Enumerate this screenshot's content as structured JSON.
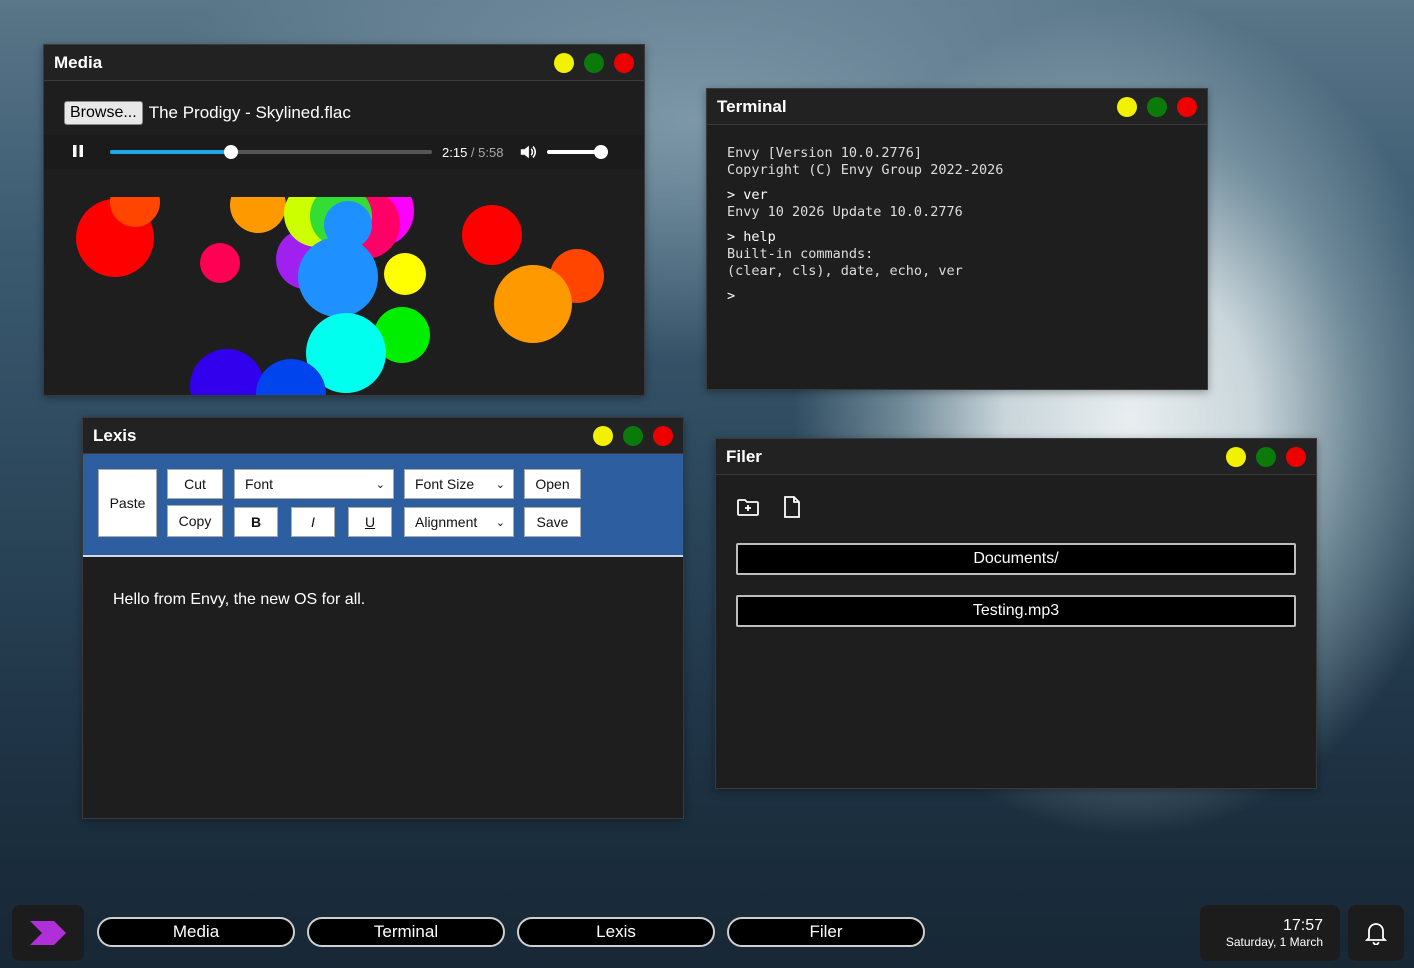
{
  "media": {
    "title": "Media",
    "browse_label": "Browse...",
    "filename": "The Prodigy - Skylined.flac",
    "current_time": "2:15",
    "separator": " / ",
    "duration": "5:58",
    "progress_fraction": 0.377,
    "volume_fraction": 1.0
  },
  "terminal": {
    "title": "Terminal",
    "lines": [
      "Envy [Version 10.0.2776]",
      "Copyright (C) Envy Group 2022-2026",
      "> ver",
      "Envy 10 2026 Update 10.0.2776",
      "> help",
      "Built-in commands:",
      "(clear, cls), date, echo, ver",
      ">"
    ]
  },
  "lexis": {
    "title": "Lexis",
    "paste": "Paste",
    "cut": "Cut",
    "copy": "Copy",
    "font": "Font",
    "font_size": "Font Size",
    "bold": "B",
    "italic": "I",
    "underline": "U",
    "alignment": "Alignment",
    "open": "Open",
    "save": "Save",
    "content": "Hello from Envy, the new OS for all."
  },
  "filer": {
    "title": "Filer",
    "items": [
      "Documents/",
      "Testing.mp3"
    ]
  },
  "taskbar": {
    "apps": [
      "Media",
      "Terminal",
      "Lexis",
      "Filer"
    ],
    "time": "17:57",
    "date": "Saturday, 1 March"
  },
  "colors": {
    "accent": "#1ea7e9",
    "lexis_toolbar": "#2d5fa0",
    "start_icon": "#b12fd8",
    "minimize": "#f2f200",
    "maximize": "#0a7a0a",
    "close": "#ee0000"
  },
  "icons": [
    "pause-icon",
    "volume-icon",
    "new-folder-icon",
    "new-file-icon",
    "start-logo-icon",
    "bell-icon"
  ]
}
